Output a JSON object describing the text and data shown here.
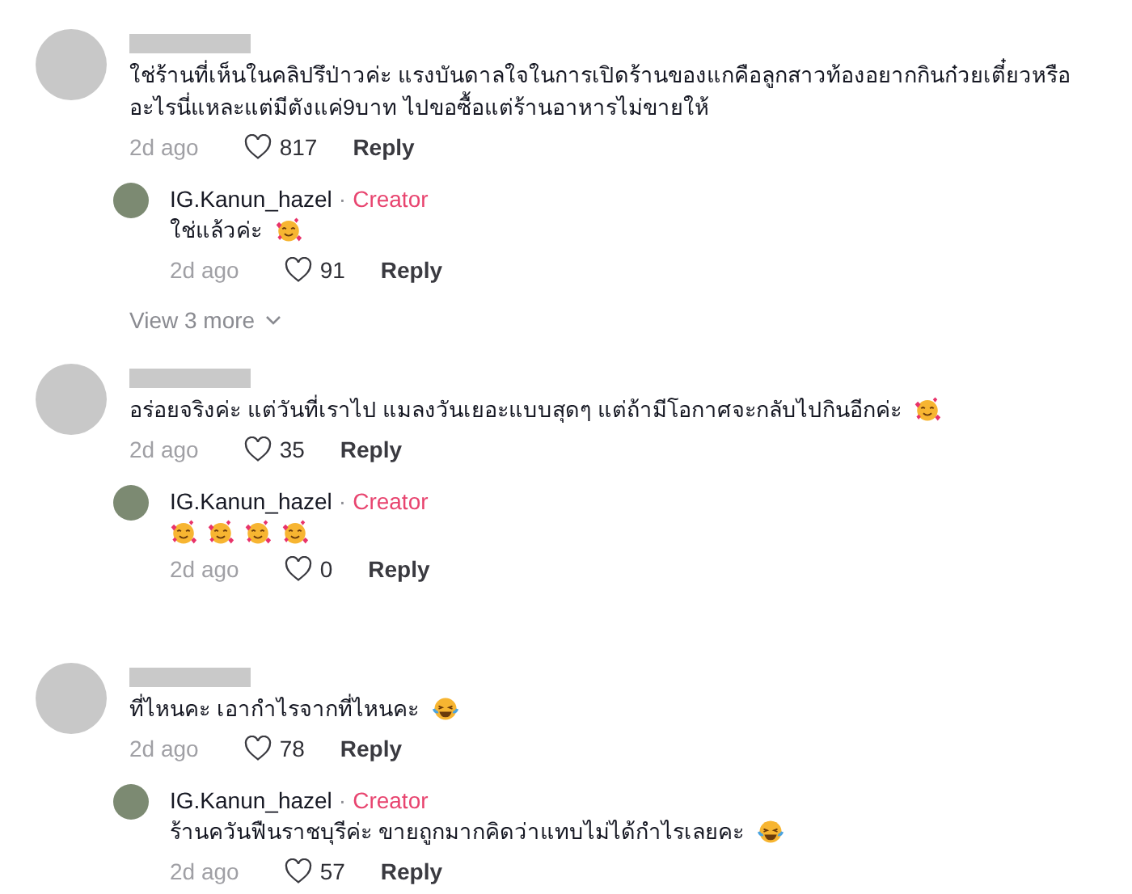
{
  "comments": [
    {
      "text": "ใช่ร้านที่เห็นในคลิปรึป่าวค่ะ แรงบันดาลใจในการเปิดร้านของแกคือลูกสาวท้องอยากกินก๋วยเตี๋ยวหรืออะไรนี่แหละแต่มีตังแค่9บาท ไปขอซื้อแต่ร้านอาหารไม่ขายให้",
      "time": "2d ago",
      "likes": "817",
      "reply_label": "Reply",
      "replies": [
        {
          "author": "IG.Kanun_hazel",
          "separator": "·",
          "badge": "Creator",
          "text": "ใช่แล้วค่ะ",
          "emojis": [
            {
              "kind": "hearts"
            }
          ],
          "time": "2d ago",
          "likes": "91",
          "reply_label": "Reply"
        }
      ],
      "view_more": "View 3 more"
    },
    {
      "text": "อร่อยจริงค่ะ แต่วันที่เราไป แมลงวันเยอะแบบสุดๆ แต่ถ้ามีโอกาศจะกลับไปกินอีกค่ะ",
      "emojis": [
        {
          "kind": "hearts"
        }
      ],
      "time": "2d ago",
      "likes": "35",
      "reply_label": "Reply",
      "replies": [
        {
          "author": "IG.Kanun_hazel",
          "separator": "·",
          "badge": "Creator",
          "emojis": [
            {
              "kind": "hearts"
            },
            {
              "kind": "hearts"
            },
            {
              "kind": "hearts"
            },
            {
              "kind": "hearts"
            }
          ],
          "time": "2d ago",
          "likes": "0",
          "reply_label": "Reply"
        }
      ]
    },
    {
      "text": "ที่ไหนคะ เอากำไรจากที่ไหนคะ",
      "emojis": [
        {
          "kind": "laughing"
        }
      ],
      "time": "2d ago",
      "likes": "78",
      "reply_label": "Reply",
      "replies": [
        {
          "author": "IG.Kanun_hazel",
          "separator": "·",
          "badge": "Creator",
          "text": "ร้านควันฟืนราชบุรีค่ะ ขายถูกมากคิดว่าแทบไม่ได้กำไรเลยคะ",
          "emojis": [
            {
              "kind": "laughing"
            }
          ],
          "time": "2d ago",
          "likes": "57",
          "reply_label": "Reply"
        }
      ]
    }
  ]
}
